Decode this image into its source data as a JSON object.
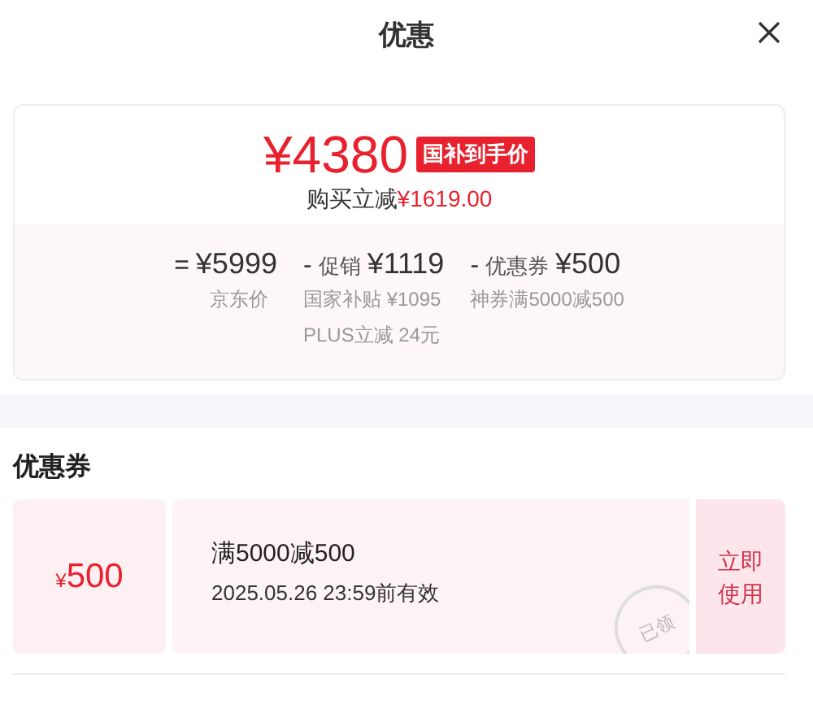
{
  "header": {
    "title": "优惠"
  },
  "summary": {
    "price": "¥4380",
    "badge": "国补到手价",
    "saving_label": "购买立减",
    "saving_amount": "¥1619.00"
  },
  "breakdown": [
    {
      "operator": "=",
      "amount": "¥5999",
      "notes": [
        "京东价"
      ]
    },
    {
      "operator": "-",
      "label": "促销",
      "amount": "¥1119",
      "notes": [
        "国家补贴 ¥1095",
        "PLUS立减 24元"
      ]
    },
    {
      "operator": "-",
      "label": "优惠券",
      "amount": "¥500",
      "notes": [
        "神券满5000减500"
      ]
    }
  ],
  "coupons": {
    "title": "优惠券",
    "items": [
      {
        "currency": "¥",
        "value": "500",
        "condition": "满5000减500",
        "validity": "2025.05.26 23:59前有效",
        "stamp": "已领",
        "action": "立即使用"
      }
    ]
  }
}
